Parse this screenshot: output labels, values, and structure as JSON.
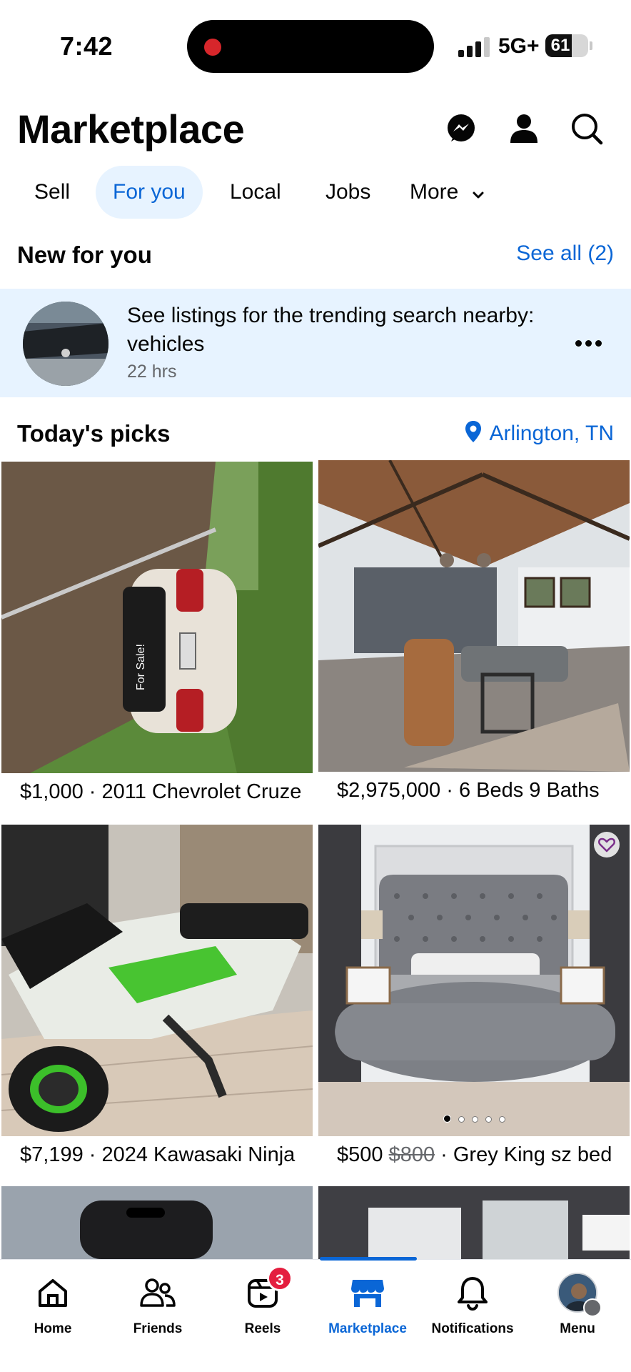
{
  "status_bar": {
    "time": "7:42",
    "network": "5G+",
    "battery": "61",
    "battery_level": 0.61
  },
  "header": {
    "title": "Marketplace",
    "icons": [
      "messenger-icon",
      "profile-icon",
      "search-icon"
    ]
  },
  "tabs": [
    {
      "label": "Sell",
      "active": false
    },
    {
      "label": "For you",
      "active": true
    },
    {
      "label": "Local",
      "active": false
    },
    {
      "label": "Jobs",
      "active": false
    },
    {
      "label": "More",
      "active": false
    }
  ],
  "new_for_you": {
    "title": "New for you",
    "see_all": "See all (2)",
    "notification": {
      "text": "See listings for the trending search nearby: vehicles",
      "time": "22 hrs"
    }
  },
  "todays_picks": {
    "title": "Today's picks",
    "location": "Arlington, TN",
    "listings": [
      {
        "price": "$1,000",
        "separator": " · ",
        "title": "2011 Chevrolet Cruze"
      },
      {
        "price": "$2,975,000",
        "separator": " · ",
        "title": "6 Beds 9 Baths"
      },
      {
        "price": "$7,199",
        "separator": " · ",
        "title": "2024 Kawasaki Ninja"
      },
      {
        "price": "$500",
        "old_price": "$800",
        "separator": " · ",
        "title": "Grey King sz bed"
      }
    ]
  },
  "bottom_nav": {
    "items": [
      {
        "label": "Home",
        "icon": "home-icon"
      },
      {
        "label": "Friends",
        "icon": "friends-icon"
      },
      {
        "label": "Reels",
        "icon": "reels-icon",
        "badge": "3"
      },
      {
        "label": "Marketplace",
        "icon": "marketplace-icon",
        "active": true
      },
      {
        "label": "Notifications",
        "icon": "bell-icon"
      },
      {
        "label": "Menu",
        "icon": "avatar"
      }
    ]
  },
  "colors": {
    "accent": "#0a66d6",
    "active_tab_bg": "#e7f3ff",
    "badge": "#e41e3f"
  }
}
